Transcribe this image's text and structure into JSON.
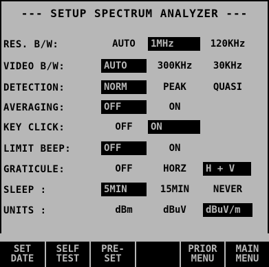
{
  "title": "--- SETUP SPECTRUM ANALYZER ---",
  "rows": [
    {
      "label": "RES. B/W:",
      "options": [
        "AUTO",
        "1MHz",
        "120KHz"
      ],
      "selected": "1MHz"
    },
    {
      "label": "VIDEO B/W:",
      "options": [
        "AUTO",
        "300KHz",
        "30KHz"
      ],
      "selected": "AUTO"
    },
    {
      "label": "DETECTION:",
      "options": [
        "NORM",
        "PEAK",
        "QUASI"
      ],
      "selected": "NORM"
    },
    {
      "label": "AVERAGING:",
      "options": [
        "OFF",
        "ON"
      ],
      "selected": "OFF"
    },
    {
      "label": "KEY CLICK:",
      "options": [
        "OFF",
        "ON"
      ],
      "selected": "ON"
    },
    {
      "label": "LIMIT BEEP:",
      "options": [
        "OFF",
        "ON"
      ],
      "selected": "OFF"
    },
    {
      "label": "GRATICULE:",
      "options": [
        "OFF",
        "HORZ",
        "H + V"
      ],
      "selected": "H + V"
    },
    {
      "label": "SLEEP :",
      "options": [
        "5MIN",
        "15MIN",
        "NEVER"
      ],
      "selected": "5MIN"
    },
    {
      "label": "UNITS :",
      "options": [
        "dBm",
        "dBuV",
        "dBuV/m"
      ],
      "selected": "dBuV/m"
    }
  ],
  "softkeys": [
    {
      "line1": "SET",
      "line2": "DATE"
    },
    {
      "line1": "SELF",
      "line2": "TEST"
    },
    {
      "line1": "PRE-",
      "line2": "SET"
    },
    {
      "line1": "",
      "line2": ""
    },
    {
      "line1": "PRIOR",
      "line2": "MENU"
    },
    {
      "line1": "MAIN",
      "line2": "MENU"
    }
  ],
  "colors": {
    "screen": "#b7b7b7",
    "ink": "#000000"
  }
}
